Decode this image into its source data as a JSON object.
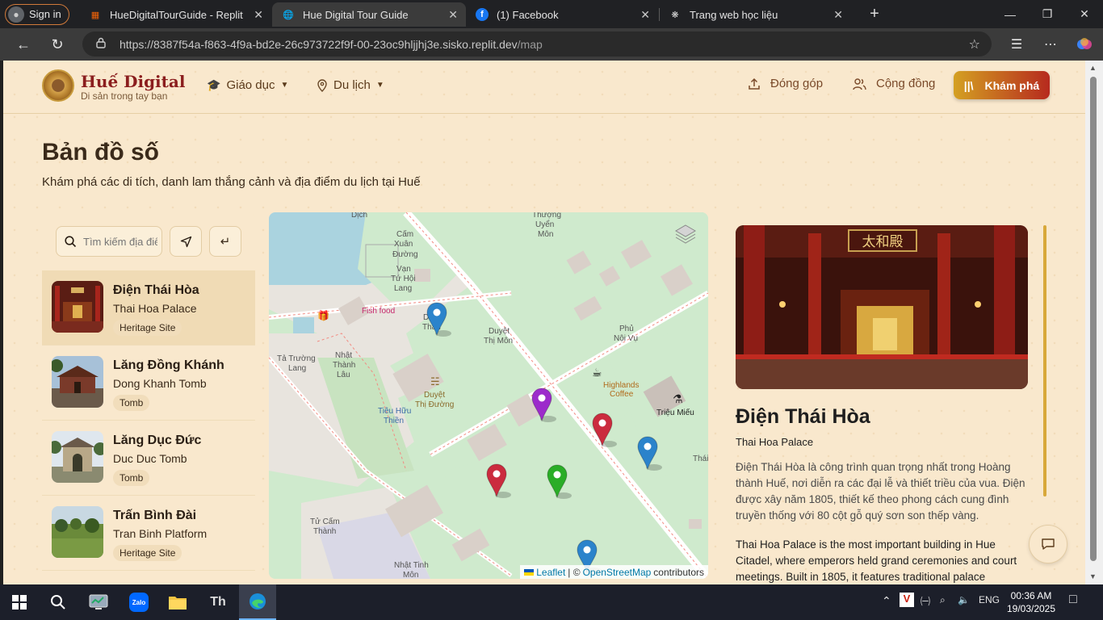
{
  "browser": {
    "signin_label": "Sign in",
    "tabs": [
      {
        "title": "HueDigitalTourGuide - Replit",
        "icon": "replit-icon"
      },
      {
        "title": "Hue Digital Tour Guide",
        "icon": "globe-icon"
      },
      {
        "title": "(1) Facebook",
        "icon": "facebook-icon"
      },
      {
        "title": "Trang web học liệu",
        "icon": "openai-icon"
      }
    ],
    "url_host": "https://8387f54a-f863-4f9a-bd2e-26c973722f9f-00-23oc9hljjhj3e.sisko.replit.dev",
    "url_path": "/map"
  },
  "site": {
    "brand": "Huế Digital",
    "tagline": "Di sản trong tay bạn",
    "menu": [
      {
        "label": "Giáo dục",
        "icon": "graduation-cap-icon"
      },
      {
        "label": "Du lịch",
        "icon": "map-pin-icon"
      }
    ],
    "contribute": "Đóng góp",
    "community": "Cộng đồng",
    "explore": "Khám phá"
  },
  "page": {
    "title": "Bản đồ số",
    "subtitle": "Khám phá các di tích, danh lam thắng cảnh và địa điểm du lịch tại Huế"
  },
  "search": {
    "placeholder": "Tìm kiếm địa điểm"
  },
  "places": [
    {
      "name": "Điện Thái Hòa",
      "en": "Thai Hoa Palace",
      "type": "Heritage Site",
      "selected": true
    },
    {
      "name": "Lăng Đồng Khánh",
      "en": "Dong Khanh Tomb",
      "type": "Tomb"
    },
    {
      "name": "Lăng Dục Đức",
      "en": "Duc Duc Tomb",
      "type": "Tomb"
    },
    {
      "name": "Trấn Bình Đài",
      "en": "Tran Binh Platform",
      "type": "Heritage Site"
    }
  ],
  "map": {
    "labels": {
      "dich": "Dịch",
      "uyen1": "Thượng",
      "uyen2": "Uyển",
      "uyen3": "Môn",
      "cam1": "Cấm",
      "cam2": "Xuân",
      "cam3": "Đường",
      "van1": "Vạn",
      "van2": "Tứ Hội",
      "van3": "Lang",
      "fishfood": "Fish food",
      "duyetthan1": "Duyệt",
      "duyetthan2": "Thân",
      "duyetthi1": "Duyệt",
      "duyetthi2": "Thị Môn",
      "phu1": "Phủ",
      "phu2": "Nội Vụ",
      "tatruong1": "Tả Trường",
      "tatruong2": "Lang",
      "nhat1": "Nhật",
      "nhat2": "Thành",
      "nhat3": "Lâu",
      "dtd1": "Duyệt",
      "dtd2": "Thị Đường",
      "hl1": "Highlands",
      "hl2": "Coffee",
      "trieumieu": "Triệu Miếu",
      "tieu1": "Tiêu Hữu",
      "tieu2": "Thiền",
      "thai": "Thái",
      "tucam1": "Tử Cấm",
      "tucam2": "Thành",
      "nhattinh1": "Nhật Tinh",
      "nhattinh2": "Môn"
    },
    "attribution_leaflet": "Leaflet",
    "attribution_mid": "| ©",
    "attribution_osm": "OpenStreetMap",
    "attribution_end": "contributors",
    "markers": [
      {
        "color": "#2b83cb"
      },
      {
        "color": "#9c2bcb"
      },
      {
        "color": "#cb2b3e"
      },
      {
        "color": "#2b83cb"
      },
      {
        "color": "#cb2b3e"
      },
      {
        "color": "#2aad27"
      },
      {
        "color": "#2b83cb"
      }
    ]
  },
  "detail": {
    "title": "Điện Thái Hòa",
    "en": "Thai Hoa Palace",
    "desc_vi": "Điện Thái Hòa là công trình quan trọng nhất trong Hoàng thành Huế, nơi diễn ra các đại lễ và thiết triều của vua. Điện được xây năm 1805, thiết kế theo phong cách cung đình truyền thống với 80 cột gỗ quý sơn son thếp vàng.",
    "desc_en": "Thai Hoa Palace is the most important building in Hue Citadel, where emperors held grand ceremonies and court meetings. Built in 1805, it features traditional palace",
    "sign_text": "太和殿"
  },
  "taskbar": {
    "lang": "ENG",
    "time": "00:36 AM",
    "date": "19/03/2025"
  },
  "colors": {
    "page_bg": "#f9e8cd",
    "brand_red": "#8b1e1e",
    "cta_start": "#d4a022",
    "cta_end": "#b62a1e"
  }
}
